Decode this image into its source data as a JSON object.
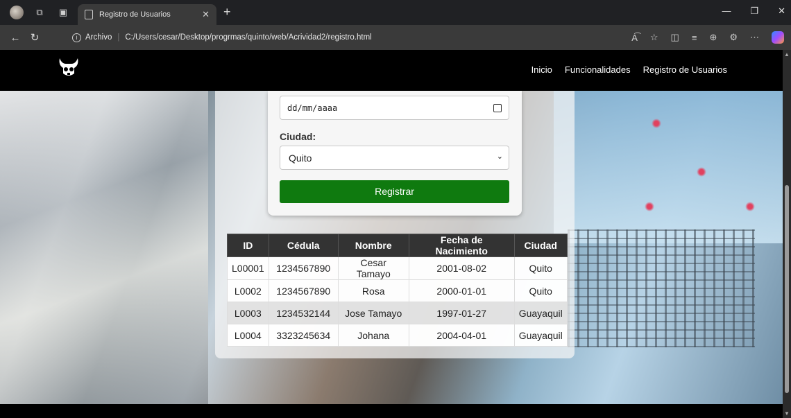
{
  "browser": {
    "tab_title": "Registro de Usuarios",
    "address_prefix": "Archivo",
    "url": "C:/Users/cesar/Desktop/progrmas/quinto/web/Acrividad2/registro.html"
  },
  "nav": {
    "items": [
      {
        "label": "Inicio"
      },
      {
        "label": "Funcionalidades"
      },
      {
        "label": "Registro de Usuarios"
      }
    ]
  },
  "form": {
    "date_placeholder": "dd/mm/aaaa",
    "city_label": "Ciudad:",
    "city_value": "Quito",
    "submit_label": "Registrar"
  },
  "table": {
    "headers": [
      "ID",
      "Cédula",
      "Nombre",
      "Fecha de Nacimiento",
      "Ciudad"
    ],
    "rows": [
      [
        "L00001",
        "1234567890",
        "Cesar Tamayo",
        "2001-08-02",
        "Quito"
      ],
      [
        "L0002",
        "1234567890",
        "Rosa",
        "2000-01-01",
        "Quito"
      ],
      [
        "L0003",
        "1234532144",
        "Jose Tamayo",
        "1997-01-27",
        "Guayaquil"
      ],
      [
        "L0004",
        "3323245634",
        "Johana",
        "2004-04-01",
        "Guayaquil"
      ]
    ]
  },
  "colors": {
    "button_green": "#0f7a0f",
    "header_dark": "#333333",
    "navbar": "#000000"
  }
}
